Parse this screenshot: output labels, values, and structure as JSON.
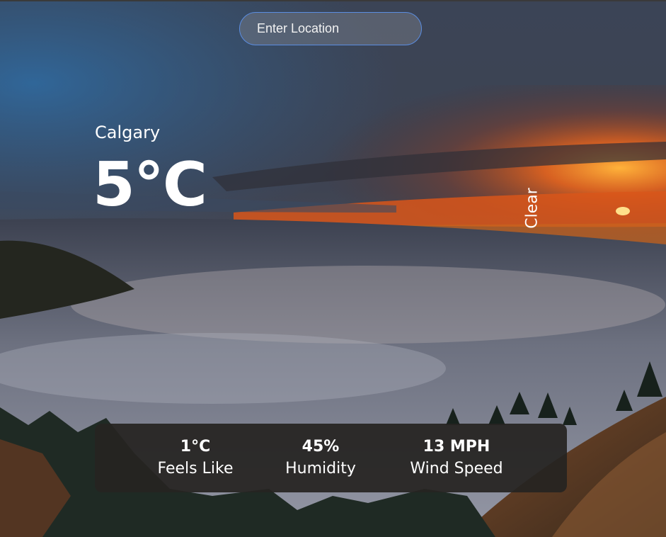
{
  "search": {
    "placeholder": "Enter Location",
    "value": ""
  },
  "weather": {
    "city": "Calgary",
    "temperature": "5°C",
    "condition": "Clear"
  },
  "details": {
    "feels_like": {
      "value": "1°C",
      "label": "Feels Like"
    },
    "humidity": {
      "value": "45%",
      "label": "Humidity"
    },
    "wind": {
      "value": "13 MPH",
      "label": "Wind Speed"
    }
  },
  "colors": {
    "sky_top": "#3b4456",
    "sky_blue": "#2f5a86",
    "sunset_orange": "#e8641c",
    "sun": "#ffd24a",
    "fog": "#8e93a0",
    "panel_bg": "#262321",
    "input_border": "#5b8de0"
  }
}
